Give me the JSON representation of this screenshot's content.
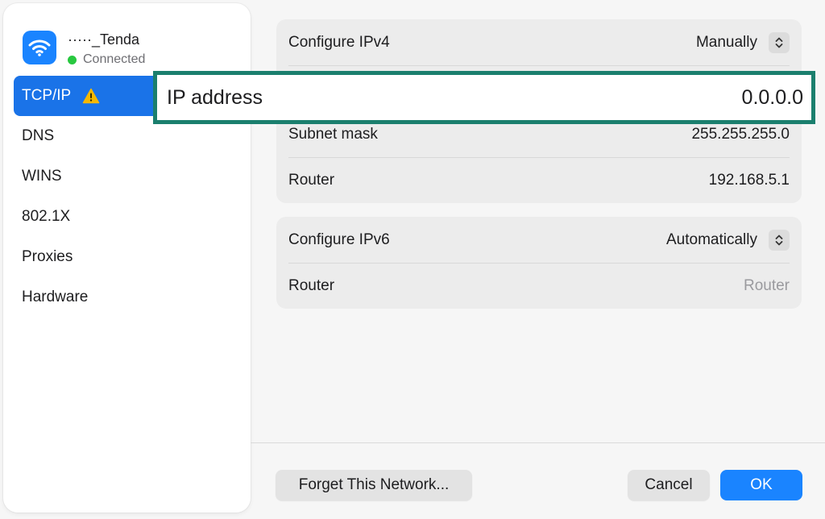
{
  "network": {
    "name": "·····_Tenda",
    "status": "Connected",
    "status_color": "#28c840",
    "icon": "wifi-icon"
  },
  "sidebar": {
    "items": [
      {
        "label": "TCP/IP",
        "active": true,
        "warning": true
      },
      {
        "label": "DNS"
      },
      {
        "label": "WINS"
      },
      {
        "label": "802.1X"
      },
      {
        "label": "Proxies"
      },
      {
        "label": "Hardware"
      }
    ]
  },
  "ipv4": {
    "configure_label": "Configure IPv4",
    "configure_value": "Manually",
    "ip_label": "IP address",
    "ip_value": "0.0.0.0",
    "subnet_label": "Subnet mask",
    "subnet_value": "255.255.255.0",
    "router_label": "Router",
    "router_value": "192.168.5.1"
  },
  "ipv6": {
    "configure_label": "Configure IPv6",
    "configure_value": "Automatically",
    "router_label": "Router",
    "router_placeholder": "Router"
  },
  "buttons": {
    "forget": "Forget This Network...",
    "cancel": "Cancel",
    "ok": "OK"
  },
  "colors": {
    "accent": "#1a84ff",
    "highlight_border": "#1b7f6e",
    "warning": "#f5b800"
  }
}
